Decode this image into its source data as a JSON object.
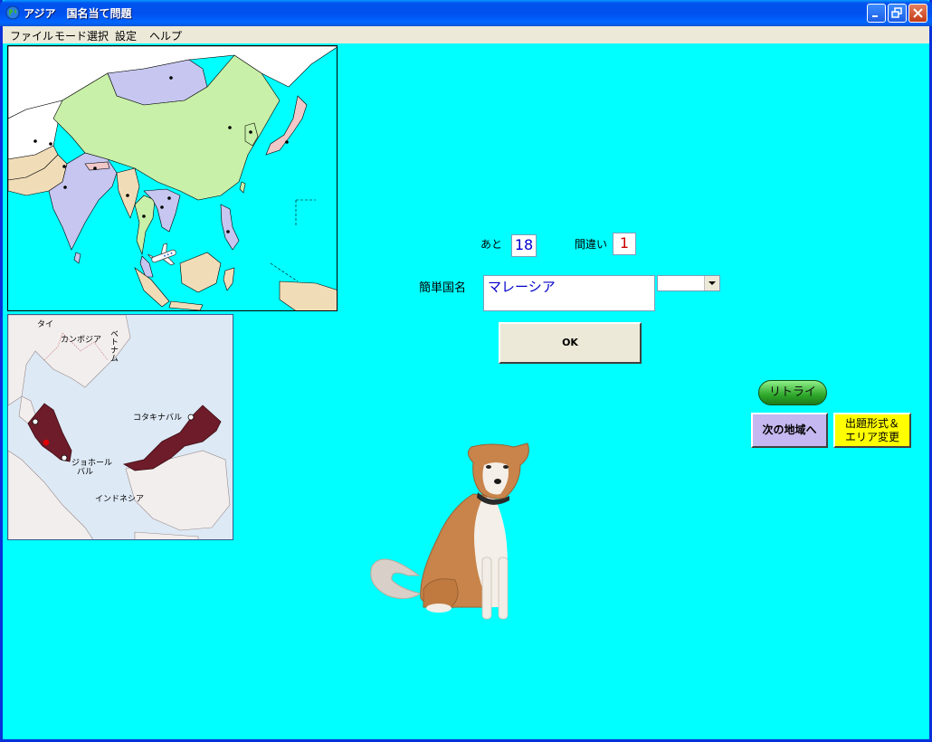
{
  "window": {
    "title": "アジア　国名当て問題"
  },
  "menu": {
    "items": [
      "ファイル",
      "モード選択",
      "設定",
      "ヘルプ"
    ]
  },
  "maps": {
    "detail_labels": {
      "thailand": "タイ",
      "cambodia": "カンボジア",
      "vietnam": "ベトナム",
      "kota_kinabalu": "コタキナバル",
      "johor_bahru_1": "ジョホール",
      "johor_bahru_2": "バル",
      "indonesia": "インドネシア"
    }
  },
  "quiz": {
    "remaining_label": "あと",
    "remaining_value": "18",
    "mistakes_label": "間違い",
    "mistakes_value": "1",
    "name_label": "簡単国名",
    "answer_value": "マレーシア",
    "ok_label": "OK"
  },
  "buttons": {
    "retry": "リトライ",
    "next_region": "次の地域へ",
    "change_mode_1": "出題形式＆",
    "change_mode_2": "エリア変更"
  },
  "colors": {
    "background": "#00ffff",
    "highlight_country": "#6e1c2a",
    "next_button": "#c5b8f0",
    "mode_button": "#ffff00",
    "retry_button": "#2ea82a"
  }
}
